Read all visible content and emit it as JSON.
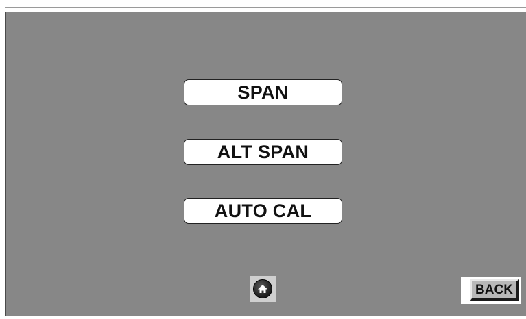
{
  "menu": {
    "span_label": "SPAN",
    "alt_span_label": "ALT SPAN",
    "auto_cal_label": "AUTO CAL"
  },
  "nav": {
    "home_icon": "home-icon",
    "back_label": "BACK"
  },
  "colors": {
    "screen_background": "#878787",
    "button_background": "#ffffff",
    "text": "#111111"
  }
}
